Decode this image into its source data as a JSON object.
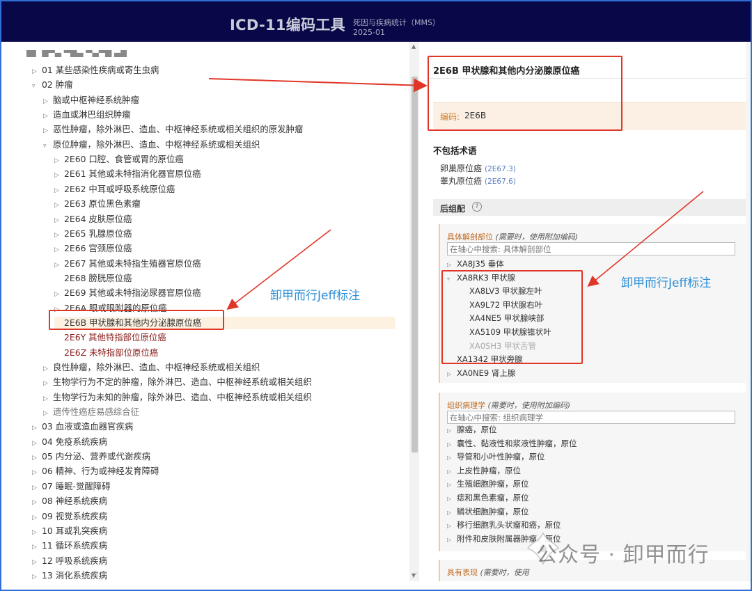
{
  "header": {
    "title": "ICD-11编码工具",
    "subtitle": "死因与疾病统计（MMS）",
    "version": "2025-01"
  },
  "left_tree": [
    {
      "indent": 0,
      "toggle": "▷",
      "text": "01 某些感染性疾病或寄生虫病"
    },
    {
      "indent": 0,
      "toggle": "▿",
      "text": "02 肿瘤"
    },
    {
      "indent": 1,
      "toggle": "▷",
      "text": "脑或中枢神经系统肿瘤"
    },
    {
      "indent": 1,
      "toggle": "▷",
      "text": "造血或淋巴组织肿瘤"
    },
    {
      "indent": 1,
      "toggle": "▷",
      "text": "恶性肿瘤，除外淋巴、造血、中枢神经系统或相关组织的原发肿瘤"
    },
    {
      "indent": 1,
      "toggle": "▿",
      "text": "原位肿瘤，除外淋巴、造血、中枢神经系统或相关组织"
    },
    {
      "indent": 2,
      "toggle": "▷",
      "text": "2E60 口腔、食管或胃的原位癌"
    },
    {
      "indent": 2,
      "toggle": "▷",
      "text": "2E61 其他或未特指消化器官原位癌"
    },
    {
      "indent": 2,
      "toggle": "▷",
      "text": "2E62 中耳或呼吸系统原位癌"
    },
    {
      "indent": 2,
      "toggle": "▷",
      "text": "2E63 原位黑色素瘤"
    },
    {
      "indent": 2,
      "toggle": "▷",
      "text": "2E64 皮肤原位癌"
    },
    {
      "indent": 2,
      "toggle": "▷",
      "text": "2E65 乳腺原位癌"
    },
    {
      "indent": 2,
      "toggle": "▷",
      "text": "2E66 宫颈原位癌"
    },
    {
      "indent": 2,
      "toggle": "▷",
      "text": "2E67 其他或未特指生殖器官原位癌"
    },
    {
      "indent": 2,
      "toggle": "",
      "text": "2E68 膀胱原位癌"
    },
    {
      "indent": 2,
      "toggle": "▷",
      "text": "2E69 其他或未特指泌尿器官原位癌"
    },
    {
      "indent": 2,
      "toggle": "▷",
      "text": "2E6A 眼或眼附器的原位癌"
    },
    {
      "indent": 2,
      "toggle": "",
      "text": "2E6B 甲状腺和其他内分泌腺原位癌",
      "state": "selected"
    },
    {
      "indent": 2,
      "toggle": "",
      "text": "2E6Y 其他特指部位原位癌",
      "state": "dark-red"
    },
    {
      "indent": 2,
      "toggle": "",
      "text": "2E6Z 未特指部位原位癌",
      "state": "dark-red"
    },
    {
      "indent": 1,
      "toggle": "▷",
      "text": "良性肿瘤，除外淋巴、造血、中枢神经系统或相关组织"
    },
    {
      "indent": 1,
      "toggle": "▷",
      "text": "生物学行为不定的肿瘤，除外淋巴、造血、中枢神经系统或相关组织"
    },
    {
      "indent": 1,
      "toggle": "▷",
      "text": "生物学行为未知的肿瘤，除外淋巴、造血、中枢神经系统或相关组织"
    },
    {
      "indent": 1,
      "toggle": "▷",
      "text": "遗传性癌症易感综合征",
      "state": "gray"
    },
    {
      "indent": 0,
      "toggle": "▷",
      "text": "03 血液或造血器官疾病"
    },
    {
      "indent": 0,
      "toggle": "▷",
      "text": "04 免疫系统疾病"
    },
    {
      "indent": 0,
      "toggle": "▷",
      "text": "05 内分泌、营养或代谢疾病"
    },
    {
      "indent": 0,
      "toggle": "▷",
      "text": "06 精神、行为或神经发育障碍"
    },
    {
      "indent": 0,
      "toggle": "▷",
      "text": "07 睡眠-觉醒障碍"
    },
    {
      "indent": 0,
      "toggle": "▷",
      "text": "08 神经系统疾病"
    },
    {
      "indent": 0,
      "toggle": "▷",
      "text": "09 视觉系统疾病"
    },
    {
      "indent": 0,
      "toggle": "▷",
      "text": "10 耳或乳突疾病"
    },
    {
      "indent": 0,
      "toggle": "▷",
      "text": "11 循环系统疾病"
    },
    {
      "indent": 0,
      "toggle": "▷",
      "text": "12 呼吸系统疾病"
    },
    {
      "indent": 0,
      "toggle": "▷",
      "text": "13 消化系统疾病"
    }
  ],
  "detail": {
    "title": "2E6B 甲状腺和其他内分泌腺原位癌",
    "code_label": "编码:",
    "code_value": "2E6B",
    "exclusion_heading": "不包括术语",
    "exclusions": [
      {
        "text": "卵巢原位癌",
        "ref": "(2E67.3)"
      },
      {
        "text": "睾丸原位癌",
        "ref": "(2E67.6)"
      }
    ],
    "postcoord_label": "后组配",
    "help_symbol": "?",
    "anatomy": {
      "label": "具体解剖部位",
      "hint": "(需要时，使用附加编码)",
      "placeholder": "在轴心中搜索: 具体解剖部位",
      "rows": [
        {
          "indent": 0,
          "toggle": "▷",
          "text": "XA8J35 垂体"
        },
        {
          "indent": 0,
          "toggle": "▿",
          "text": "XA8RK3 甲状腺"
        },
        {
          "indent": 1,
          "toggle": "",
          "text": "XA8LV3 甲状腺左叶"
        },
        {
          "indent": 1,
          "toggle": "",
          "text": "XA9L72 甲状腺右叶"
        },
        {
          "indent": 1,
          "toggle": "",
          "text": "XA4NE5 甲状腺峡部"
        },
        {
          "indent": 1,
          "toggle": "",
          "text": "XA5109 甲状腺锥状叶"
        },
        {
          "indent": 1,
          "toggle": "",
          "text": "XA0SH3 甲状舌管",
          "state": "gray"
        },
        {
          "indent": 0,
          "toggle": "",
          "text": "XA1342 甲状旁腺"
        },
        {
          "indent": 0,
          "toggle": "▷",
          "text": "XA0NE9 肾上腺"
        }
      ]
    },
    "histopathology": {
      "label": "组织病理学",
      "hint": "(需要时，使用附加编码)",
      "placeholder": "在轴心中搜索: 组织病理学",
      "rows": [
        {
          "toggle": "▷",
          "text": "腺癌，原位"
        },
        {
          "toggle": "▷",
          "text": "囊性、黏液性和浆液性肿瘤，原位"
        },
        {
          "toggle": "▷",
          "text": "导管和小叶性肿瘤，原位"
        },
        {
          "toggle": "▷",
          "text": "上皮性肿瘤，原位"
        },
        {
          "toggle": "▷",
          "text": "生殖細胞肿瘤，原位"
        },
        {
          "toggle": "▷",
          "text": "痣和黑色素瘤，原位"
        },
        {
          "toggle": "▷",
          "text": "鳞状细胞肿瘤，原位"
        },
        {
          "toggle": "▷",
          "text": "移行细胞乳头状瘤和癌，原位"
        },
        {
          "toggle": "▷",
          "text": "附件和皮肤附属器肿瘤，原位"
        }
      ]
    },
    "manifestation": {
      "label": "具有表现",
      "hint": "(需要时，使用"
    }
  },
  "annotations": {
    "left_note": "卸甲而行Jeff标注",
    "right_note": "卸甲而行Jeff标注",
    "watermark": "公众号 · 卸甲而行"
  },
  "colors": {
    "header_bg": "#080848",
    "highlight_red": "#e03628",
    "annotation_blue": "#2d8fd6",
    "code_box_bg": "#fbf0e3",
    "link_blue": "#5a7fc2"
  }
}
